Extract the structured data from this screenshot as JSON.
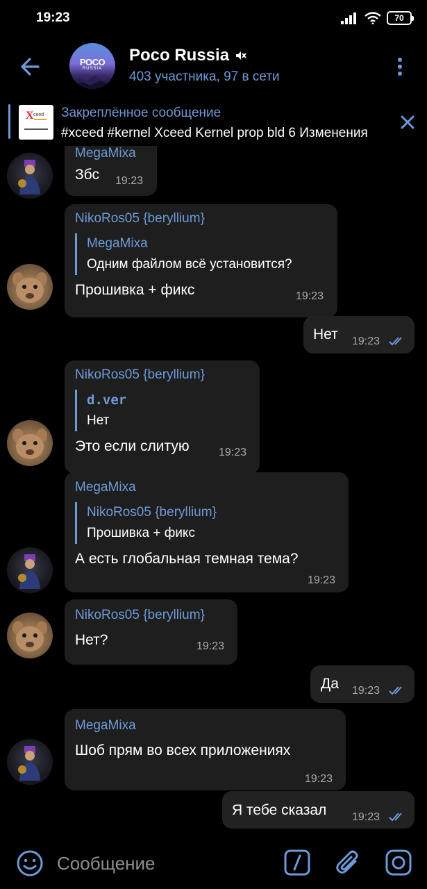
{
  "status_bar": {
    "time": "19:23",
    "battery": "70"
  },
  "header": {
    "title": "Poco Russia",
    "subtitle": "403 участника, 97 в сети",
    "avatar_logo": "POCO",
    "avatar_logo_sub": "RUSSIA"
  },
  "pinned": {
    "title": "Закреплённое сообщение",
    "text": "#xceed #kernel Xceed Kernel prop bld 6  Изменения",
    "thumb_brand": "Xceed"
  },
  "messages": [
    {
      "sender": "MegaMixa",
      "text": "Збс",
      "time": "19:23"
    },
    {
      "sender": "NikoRos05 {beryllium}",
      "reply_name": "MegaMixa",
      "reply_text": "Одним файлом всё установится?",
      "text": "Прошивка + фикс",
      "time": "19:23"
    },
    {
      "text": "Нет",
      "time": "19:23"
    },
    {
      "sender": "NikoRos05 {beryllium}",
      "reply_name": "d.ver",
      "reply_text": "Нет",
      "text": "Это если слитую",
      "time": "19:23"
    },
    {
      "sender": "MegaMixa",
      "reply_name": "NikoRos05 {beryllium}",
      "reply_text": "Прошивка + фикс",
      "text": "А есть глобальная темная тема?",
      "time": "19:23"
    },
    {
      "sender": "NikoRos05 {beryllium}",
      "text": "Нет?",
      "time": "19:23"
    },
    {
      "text": "Да",
      "time": "19:23"
    },
    {
      "sender": "MegaMixa",
      "text": "Шоб прям во всех приложениях",
      "time": "19:23"
    },
    {
      "text": "Я тебе сказал",
      "time": "19:23"
    }
  ],
  "composer": {
    "placeholder": "Сообщение"
  },
  "colors": {
    "accent": "#6d9bd8",
    "bubble": "#1e1e1e",
    "background": "#000000"
  }
}
